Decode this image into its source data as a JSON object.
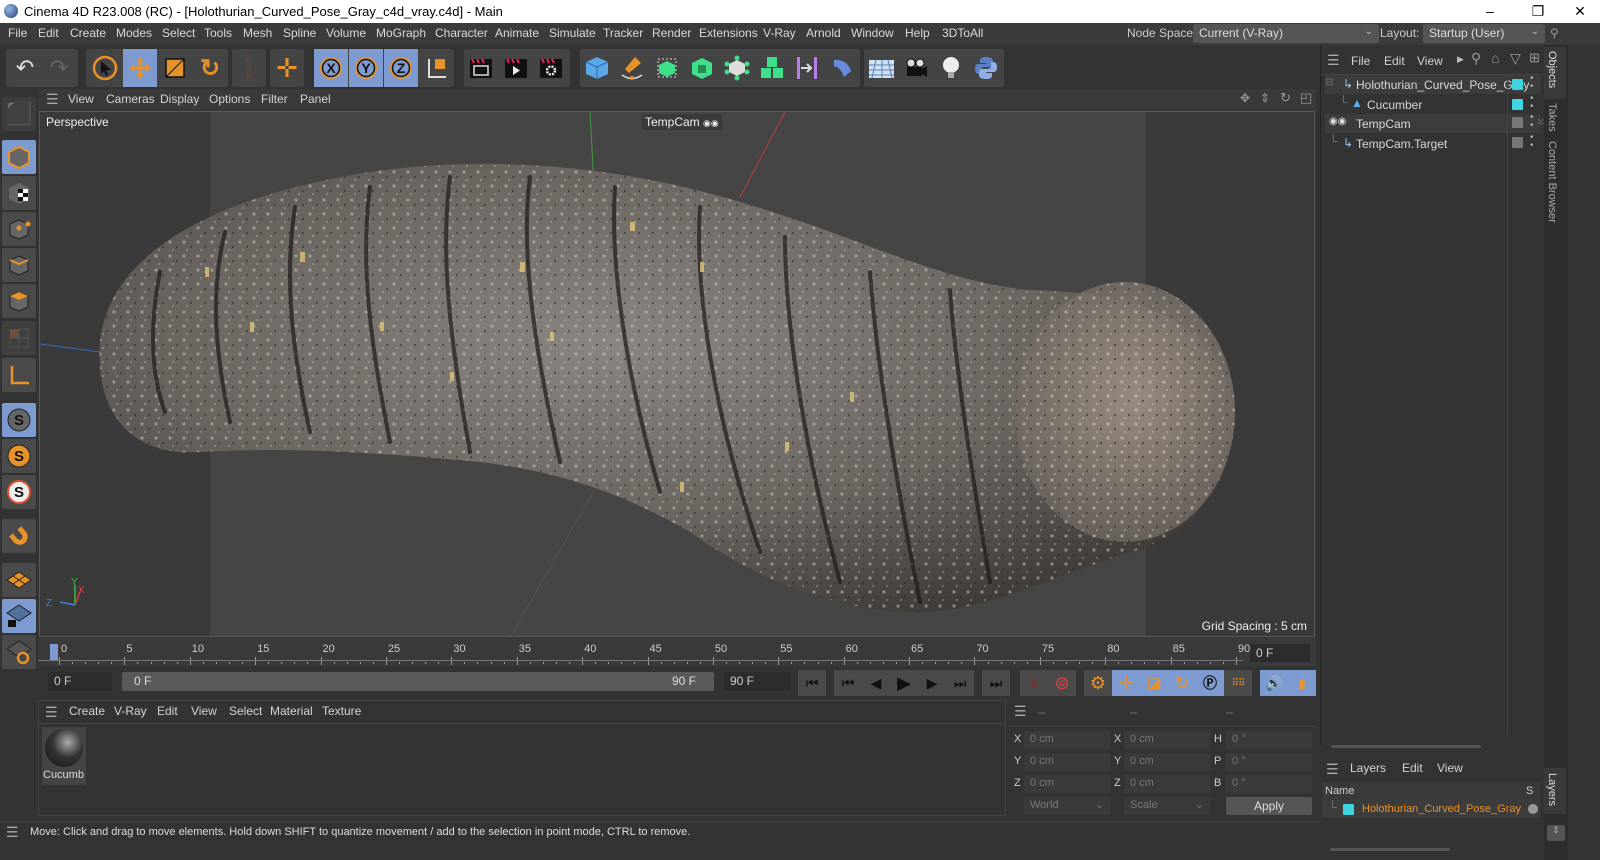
{
  "window": {
    "title": "Cinema 4D R23.008 (RC) - [Holothurian_Curved_Pose_Gray_c4d_vray.c4d] - Main",
    "min": "–",
    "max": "❐",
    "close": "✕"
  },
  "menubar": {
    "items": [
      "File",
      "Edit",
      "Create",
      "Modes",
      "Select",
      "Tools",
      "Mesh",
      "Spline",
      "Volume",
      "MoGraph",
      "Character",
      "Animate",
      "Simulate",
      "Tracker",
      "Render",
      "Extensions",
      "V-Ray",
      "Arnold",
      "Window",
      "Help",
      "3DToAll"
    ],
    "node_space_label": "Node Space:",
    "node_space_value": "Current (V-Ray)",
    "layout_label": "Layout:",
    "layout_value": "Startup (User)"
  },
  "toolbar": {
    "icons": [
      "undo-icon",
      "redo-icon",
      "select-icon",
      "move-icon",
      "scale-icon",
      "rotate-icon",
      "psr-icon",
      "coordinate-move-icon",
      "x-axis-icon",
      "y-axis-icon",
      "z-axis-icon",
      "coordinate-system-icon",
      "render-view-icon",
      "render-icon",
      "render-settings-icon",
      "cube-icon",
      "pen-icon",
      "subdivision-icon",
      "extrude-icon",
      "cloner-icon",
      "array-icon",
      "symmetry-icon",
      "deformer-icon",
      "floor-icon",
      "camera-icon",
      "light-icon",
      "python-icon"
    ]
  },
  "viewport": {
    "menu": [
      "View",
      "Cameras",
      "Display",
      "Options",
      "Filter",
      "Panel"
    ],
    "camera_label": "Perspective",
    "active_camera": "TempCam",
    "grid_spacing": "Grid Spacing : 5 cm"
  },
  "timeline": {
    "ticks": [
      "0",
      "5",
      "10",
      "15",
      "20",
      "25",
      "30",
      "35",
      "40",
      "45",
      "50",
      "55",
      "60",
      "65",
      "70",
      "75",
      "80",
      "85",
      "90"
    ],
    "current_frame": "0 F",
    "start_field": "0 F",
    "range_start": "0 F",
    "range_end": "90 F",
    "end_field": "90 F"
  },
  "material_panel": {
    "menu": [
      "Create",
      "V-Ray",
      "Edit",
      "View",
      "Select",
      "Material",
      "Texture"
    ],
    "materials": [
      {
        "name": "Cucumb"
      }
    ]
  },
  "coord_panel": {
    "headers": [
      "--",
      "--",
      "--"
    ],
    "rows": [
      {
        "l1": "X",
        "v1": "0 cm",
        "l2": "X",
        "v2": "0 cm",
        "l3": "H",
        "v3": "0 °"
      },
      {
        "l1": "Y",
        "v1": "0 cm",
        "l2": "Y",
        "v2": "0 cm",
        "l3": "P",
        "v3": "0 °"
      },
      {
        "l1": "Z",
        "v1": "0 cm",
        "l2": "Z",
        "v2": "0 cm",
        "l3": "B",
        "v3": "0 °"
      }
    ],
    "mode": "World",
    "transform": "Scale",
    "apply": "Apply"
  },
  "status": {
    "text": "Move: Click and drag to move elements. Hold down SHIFT to quantize movement / add to the selection in point mode, CTRL to remove."
  },
  "objects_panel": {
    "menu": [
      "File",
      "Edit",
      "View"
    ],
    "objects": [
      {
        "name": "Holothurian_Curved_Pose_Gray",
        "type": "null",
        "color": "#3dd6e0"
      },
      {
        "name": "Cucumber",
        "type": "polygon",
        "color": "#3dd6e0"
      },
      {
        "name": "TempCam",
        "type": "camera",
        "color": ""
      },
      {
        "name": "TempCam.Target",
        "type": "null",
        "color": ""
      }
    ]
  },
  "side_tabs": [
    "Objects",
    "Takes",
    "Content Browser",
    "Layers"
  ],
  "layers_panel": {
    "menu": [
      "Layers",
      "Edit",
      "View"
    ],
    "col_name": "Name",
    "col_s": "S",
    "layers": [
      {
        "name": "Holothurian_Curved_Pose_Gray",
        "color": "#3dd6e0"
      }
    ]
  },
  "accent": "#7d9bd0",
  "orange": "#e8922a"
}
